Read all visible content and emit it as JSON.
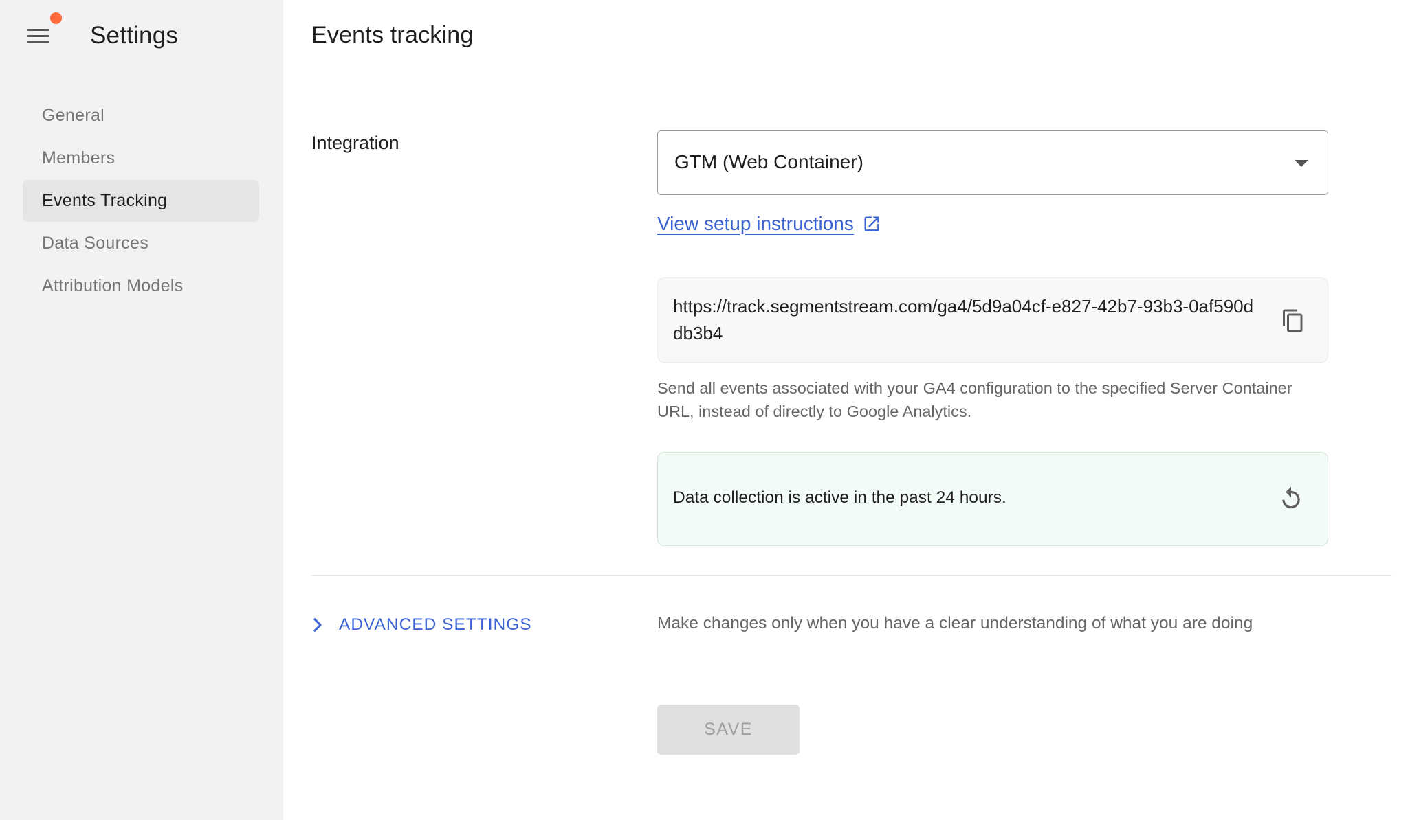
{
  "sidebar": {
    "title": "Settings",
    "items": [
      {
        "label": "General"
      },
      {
        "label": "Members"
      },
      {
        "label": "Events Tracking"
      },
      {
        "label": "Data Sources"
      },
      {
        "label": "Attribution Models"
      }
    ],
    "active_index": 2
  },
  "main": {
    "title": "Events tracking",
    "integration": {
      "label": "Integration",
      "selected": "GTM (Web Container)"
    },
    "setup_link": "View setup instructions",
    "tracking_url": "https://track.segmentstream.com/ga4/5d9a04cf-e827-42b7-93b3-0af590ddb3b4",
    "helper_text": "Send all events associated with your GA4 configuration to the specified Server Container URL, instead of directly to Google Analytics.",
    "status_text": "Data collection is active in the past 24 hours.",
    "advanced_label": "ADVANCED SETTINGS",
    "advanced_note": "Make changes only when you have a clear understanding of what you are doing",
    "save_label": "SAVE"
  },
  "colors": {
    "accent": "#3b63d4",
    "notification_dot": "#ff6b3d",
    "sidebar_bg": "#f2f2f4",
    "status_bg": "#f3fbf6"
  },
  "icons": [
    "menu-icon",
    "external-link-icon",
    "copy-icon",
    "refresh-icon",
    "chevron-right-icon",
    "dropdown-arrow-icon"
  ]
}
